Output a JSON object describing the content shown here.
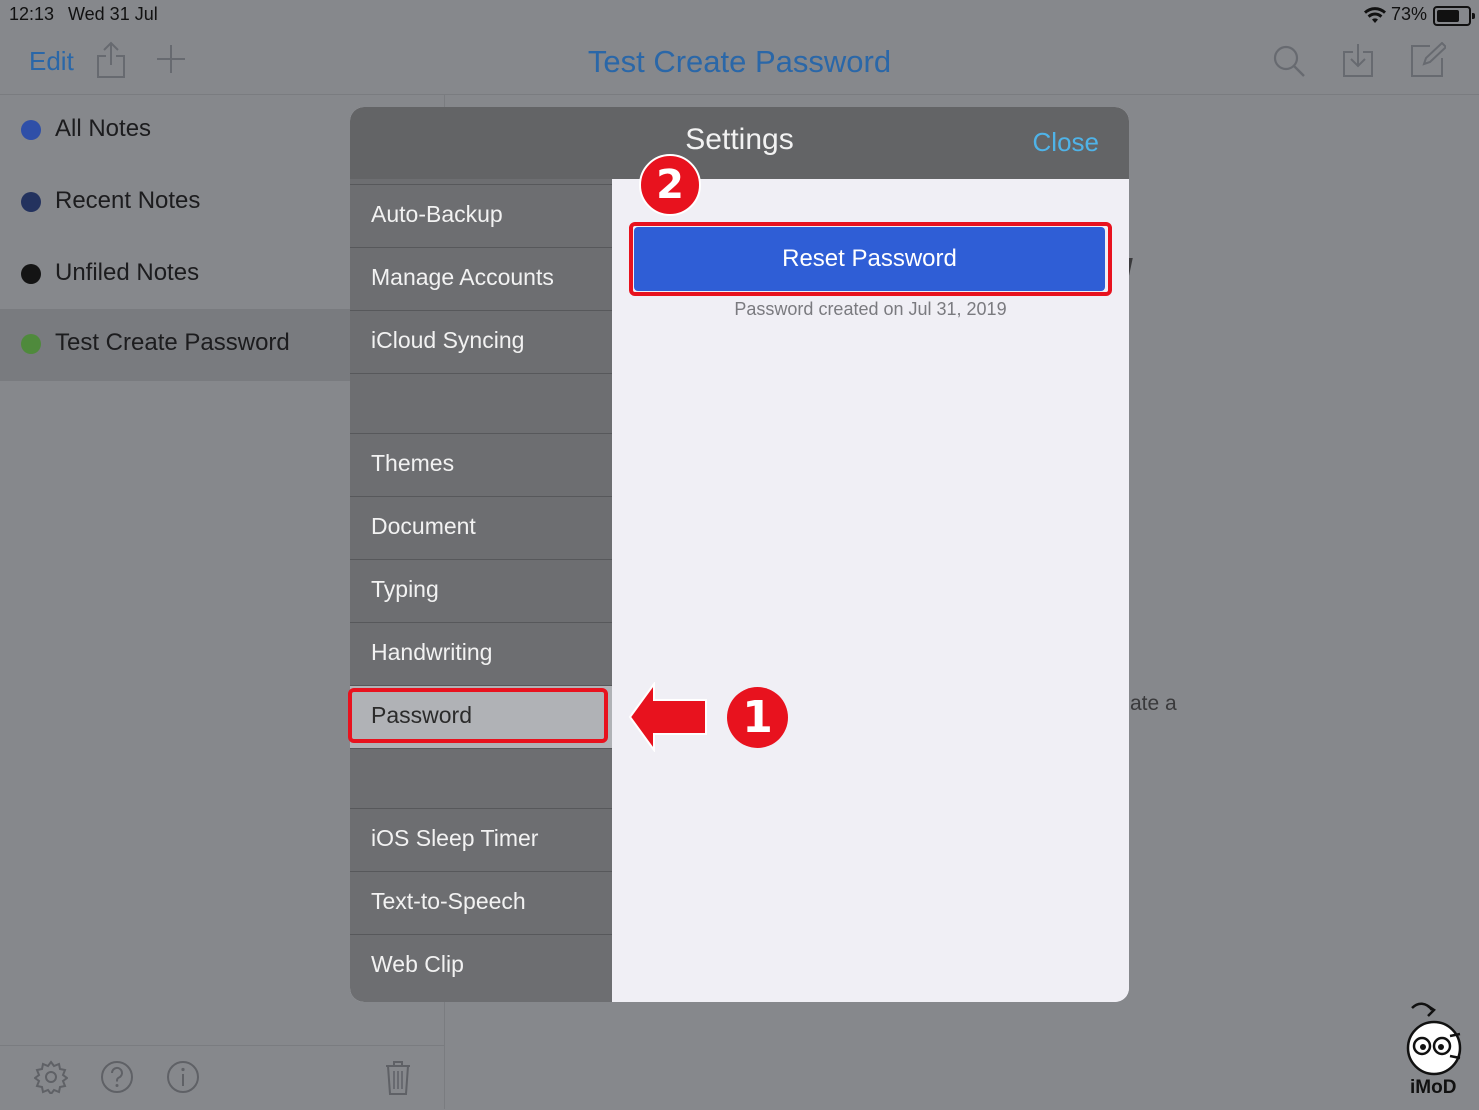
{
  "status_bar": {
    "time": "12:13",
    "date": "Wed 31 Jul",
    "battery": "73%",
    "battery_level": 0.73
  },
  "nav": {
    "edit_label": "Edit",
    "title": "Test Create Password",
    "icons": [
      "share-icon",
      "add-icon",
      "search-icon",
      "download-icon",
      "compose-icon"
    ]
  },
  "sidebar": {
    "items": [
      {
        "label": "All Notes",
        "dot_color": "#2f4fa8"
      },
      {
        "label": "Recent Notes",
        "dot_color": "#23325e"
      },
      {
        "label": "Unfiled Notes",
        "dot_color": "#141414"
      },
      {
        "label": "Test Create Password",
        "dot_color": "#4f8a3c",
        "selected": true
      }
    ],
    "toolbar_icons": [
      "gear-icon",
      "help-icon",
      "info-icon",
      "trash-icon"
    ]
  },
  "background": {
    "note_fragment": "ate a"
  },
  "settings": {
    "title": "Settings",
    "close_label": "Close",
    "menu": [
      "Auto-Backup",
      "Manage Accounts",
      "iCloud Syncing",
      "Themes",
      "Document",
      "Typing",
      "Handwriting",
      "Password",
      "iOS Sleep Timer",
      "Text-to-Speech",
      "Web Clip"
    ],
    "selected_item": "Password",
    "reset_button": "Reset Password",
    "reset_caption": "Password created on Jul 31, 2019"
  },
  "annotations": {
    "step1": "1",
    "step2": "2",
    "highlight_color": "#e8121e"
  },
  "watermark": {
    "text": "iMoD"
  }
}
